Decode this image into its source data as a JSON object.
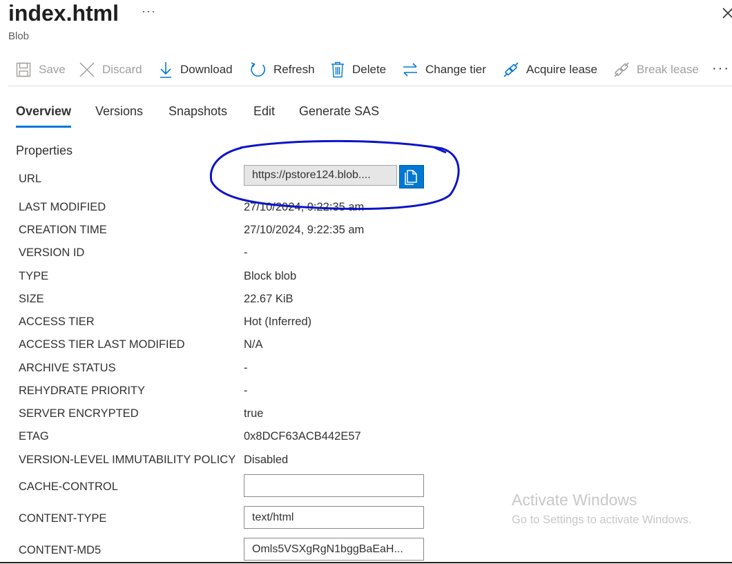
{
  "header": {
    "title": "index.html",
    "more_label": "···",
    "subtitle": "Blob"
  },
  "toolbar": {
    "save": "Save",
    "discard": "Discard",
    "download": "Download",
    "refresh": "Refresh",
    "delete": "Delete",
    "change_tier": "Change tier",
    "acquire_lease": "Acquire lease",
    "break_lease": "Break lease",
    "more": "···"
  },
  "tabs": [
    {
      "label": "Overview",
      "active": true
    },
    {
      "label": "Versions"
    },
    {
      "label": "Snapshots"
    },
    {
      "label": "Edit"
    },
    {
      "label": "Generate SAS"
    }
  ],
  "properties": {
    "section_title": "Properties",
    "url": {
      "label": "URL",
      "value": "https://pstore124.blob...."
    },
    "rows": [
      {
        "label": "LAST MODIFIED",
        "value": "27/10/2024, 9:22:35 am"
      },
      {
        "label": "CREATION TIME",
        "value": "27/10/2024, 9:22:35 am"
      },
      {
        "label": "VERSION ID",
        "value": "-"
      },
      {
        "label": "TYPE",
        "value": "Block blob"
      },
      {
        "label": "SIZE",
        "value": "22.67 KiB"
      },
      {
        "label": "ACCESS TIER",
        "value": "Hot (Inferred)"
      },
      {
        "label": "ACCESS TIER LAST MODIFIED",
        "value": "N/A"
      },
      {
        "label": "ARCHIVE STATUS",
        "value": "-"
      },
      {
        "label": "REHYDRATE PRIORITY",
        "value": "-"
      },
      {
        "label": "SERVER ENCRYPTED",
        "value": "true"
      },
      {
        "label": "ETAG",
        "value": "0x8DCF63ACB442E57"
      },
      {
        "label": "VERSION-LEVEL IMMUTABILITY POLICY",
        "value": "Disabled"
      }
    ],
    "cache_control": {
      "label": "CACHE-CONTROL",
      "value": ""
    },
    "content_type": {
      "label": "CONTENT-TYPE",
      "value": "text/html"
    },
    "content_md5": {
      "label": "CONTENT-MD5",
      "value": "Omls5VSXgRgN1bggBaEaH..."
    }
  },
  "watermark": {
    "line1": "Activate Windows",
    "line2": "Go to Settings to activate Windows."
  },
  "colors": {
    "accent": "#0078d4",
    "annotation": "#0a14c8"
  },
  "icons": [
    "save-icon",
    "discard-icon",
    "download-icon",
    "refresh-icon",
    "delete-icon",
    "change-tier-icon",
    "acquire-lease-icon",
    "break-lease-icon",
    "copy-icon",
    "close-icon"
  ]
}
